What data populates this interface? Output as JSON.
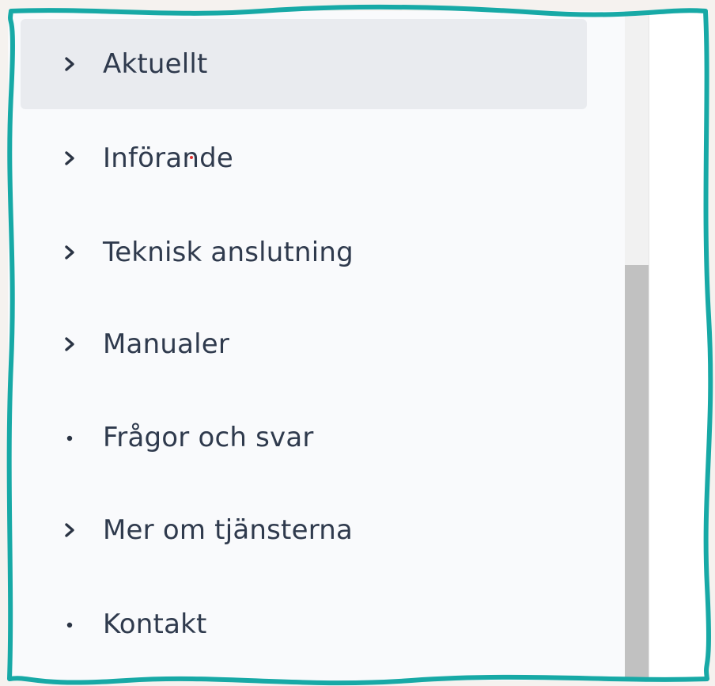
{
  "sidebar": {
    "items": [
      {
        "label": "Aktuellt",
        "icon": "chevron-right-icon",
        "active": true
      },
      {
        "label": "Införande",
        "icon": "chevron-right-icon",
        "active": false
      },
      {
        "label": "Teknisk anslutning",
        "icon": "chevron-right-icon",
        "active": false
      },
      {
        "label": "Manualer",
        "icon": "chevron-right-icon",
        "active": false
      },
      {
        "label": "Frågor och svar",
        "icon": "bullet-icon",
        "active": false
      },
      {
        "label": "Mer om tjänsterna",
        "icon": "chevron-right-icon",
        "active": false
      },
      {
        "label": "Kontakt",
        "icon": "bullet-icon",
        "active": false
      }
    ]
  },
  "colors": {
    "frame_border": "#17a9a6",
    "active_item_bg": "#e9ebef",
    "text": "#2f3a4d",
    "scrollbar_thumb": "#c1c1c1"
  }
}
